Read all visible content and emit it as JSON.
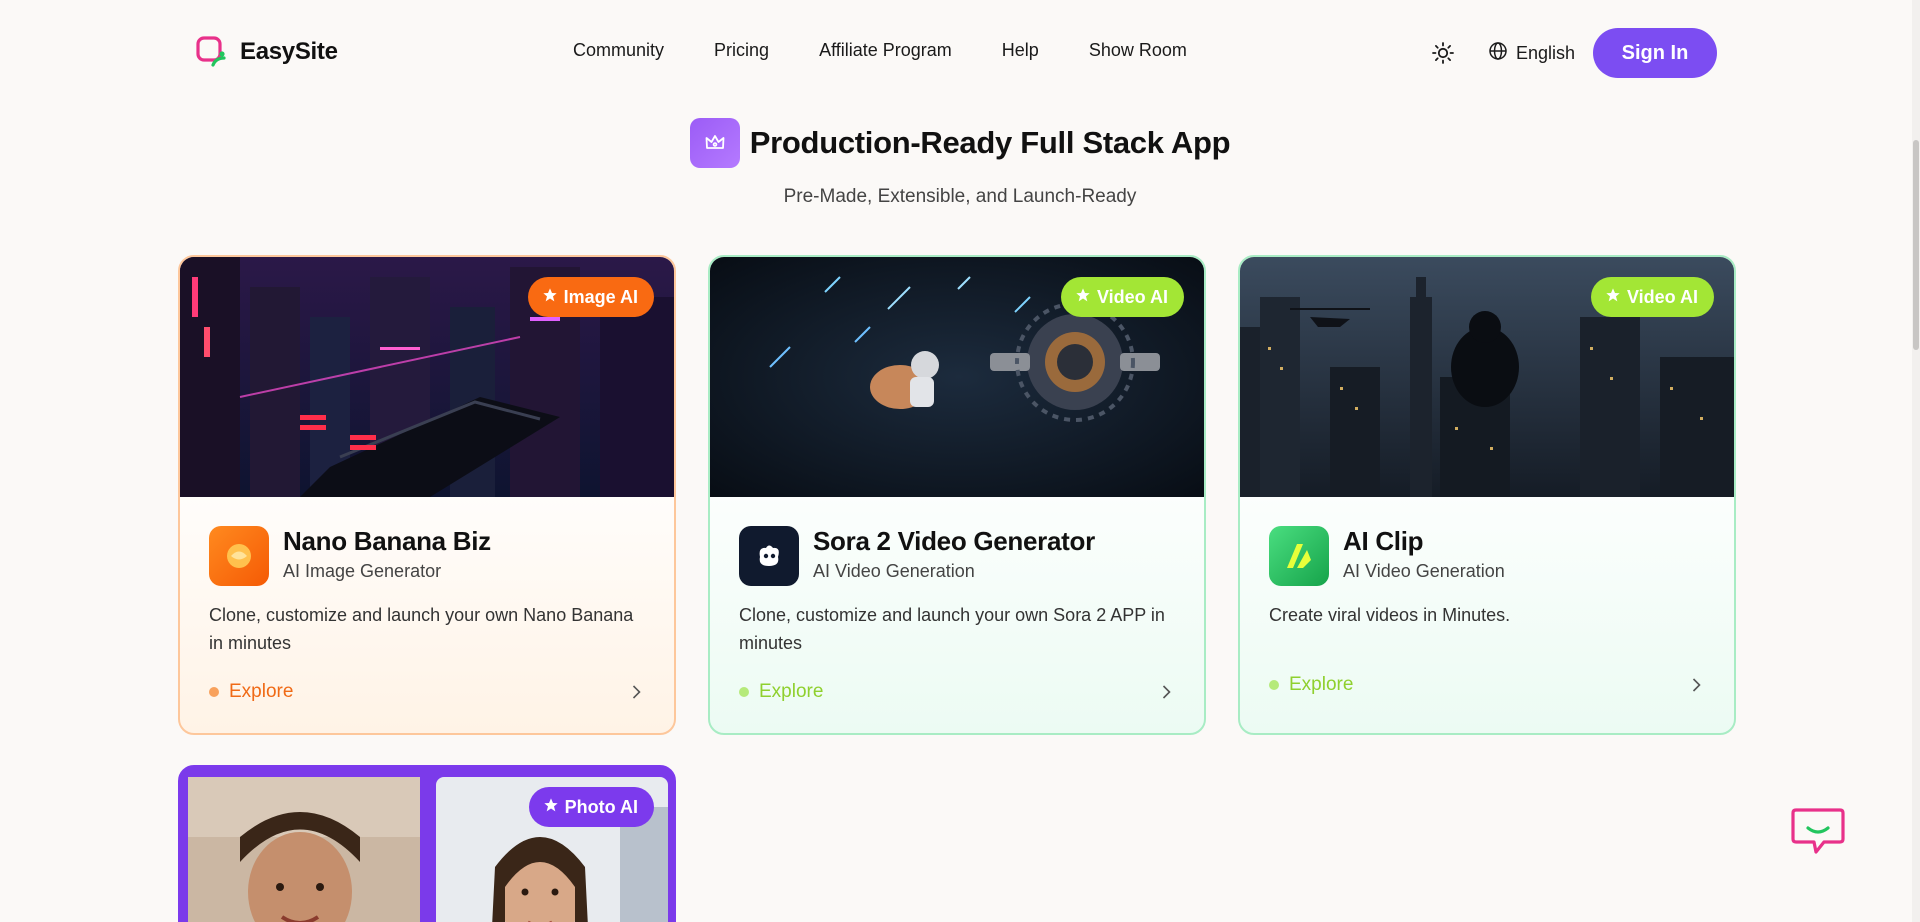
{
  "header": {
    "brand": "EasySite",
    "nav": [
      "Community",
      "Pricing",
      "Affiliate Program",
      "Help",
      "Show Room"
    ],
    "language": "English",
    "sign_in": "Sign In"
  },
  "section": {
    "title": "Production-Ready Full Stack App",
    "subtitle": "Pre-Made, Extensible, and Launch-Ready"
  },
  "cards": [
    {
      "badge": "Image AI",
      "name": "Nano Banana Biz",
      "category": "AI Image Generator",
      "description": "Clone, customize and launch your own Nano Banana in minutes",
      "cta": "Explore",
      "accent": "#f97316"
    },
    {
      "badge": "Video AI",
      "name": "Sora 2 Video Generator",
      "category": "AI Video Generation",
      "description": "Clone, customize and launch your own Sora 2 APP in minutes",
      "cta": "Explore",
      "accent": "#a3e635"
    },
    {
      "badge": "Video AI",
      "name": "AI Clip",
      "category": "AI Video Generation",
      "description": "Create viral videos in Minutes.",
      "cta": "Explore",
      "accent": "#a3e635"
    },
    {
      "badge": "Photo AI",
      "accent": "#7c3aed"
    }
  ],
  "icons": {
    "theme": "sun-icon",
    "language": "globe-icon",
    "section": "crown-icon",
    "support": "chat-bubble-icon"
  }
}
